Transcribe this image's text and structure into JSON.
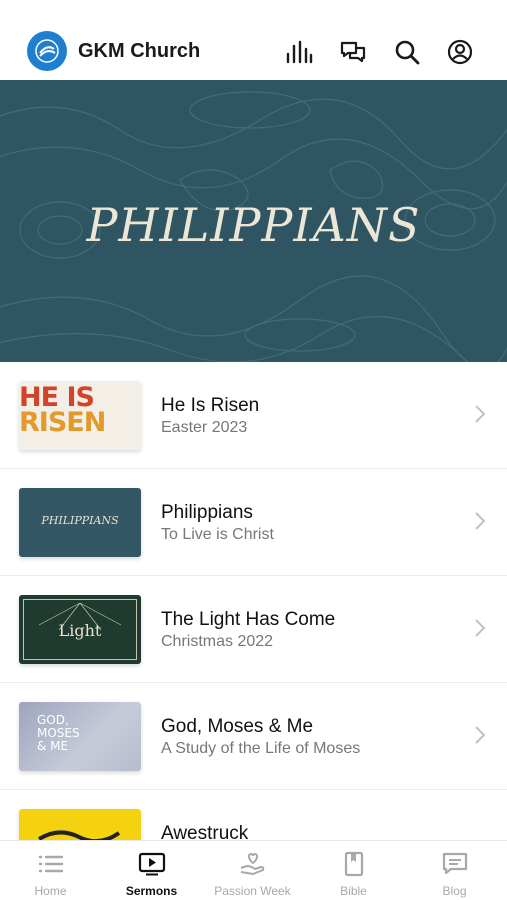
{
  "app": {
    "title": "GKM Church",
    "logo_icon": "church-logo-icon",
    "accent": "#1e7fd0"
  },
  "header_icons": [
    "live-audio-icon",
    "chat-icon",
    "search-icon",
    "profile-icon"
  ],
  "hero": {
    "title": "PHILIPPIANS",
    "background": "#2f5563"
  },
  "series": [
    {
      "title": "He Is Risen",
      "subtitle": "Easter 2023",
      "thumb_text_1": "HE IS",
      "thumb_text_2": "RISEN"
    },
    {
      "title": "Philippians",
      "subtitle": "To Live is Christ",
      "thumb_text_1": "PHILIPPIANS"
    },
    {
      "title": "The Light Has Come",
      "subtitle": "Christmas 2022",
      "thumb_text_1": "Light"
    },
    {
      "title": "God, Moses & Me",
      "subtitle": "A Study of the Life of Moses",
      "thumb_text_1": "GOD,",
      "thumb_text_2": "MOSES",
      "thumb_text_3": "& ME"
    },
    {
      "title": "Awestruck",
      "subtitle": ""
    }
  ],
  "tabs": [
    {
      "label": "Home",
      "icon": "list-icon",
      "active": false
    },
    {
      "label": "Sermons",
      "icon": "video-play-icon",
      "active": true
    },
    {
      "label": "Passion Week",
      "icon": "heart-hand-icon",
      "active": false
    },
    {
      "label": "Bible",
      "icon": "book-icon",
      "active": false
    },
    {
      "label": "Blog",
      "icon": "message-icon",
      "active": false
    }
  ]
}
